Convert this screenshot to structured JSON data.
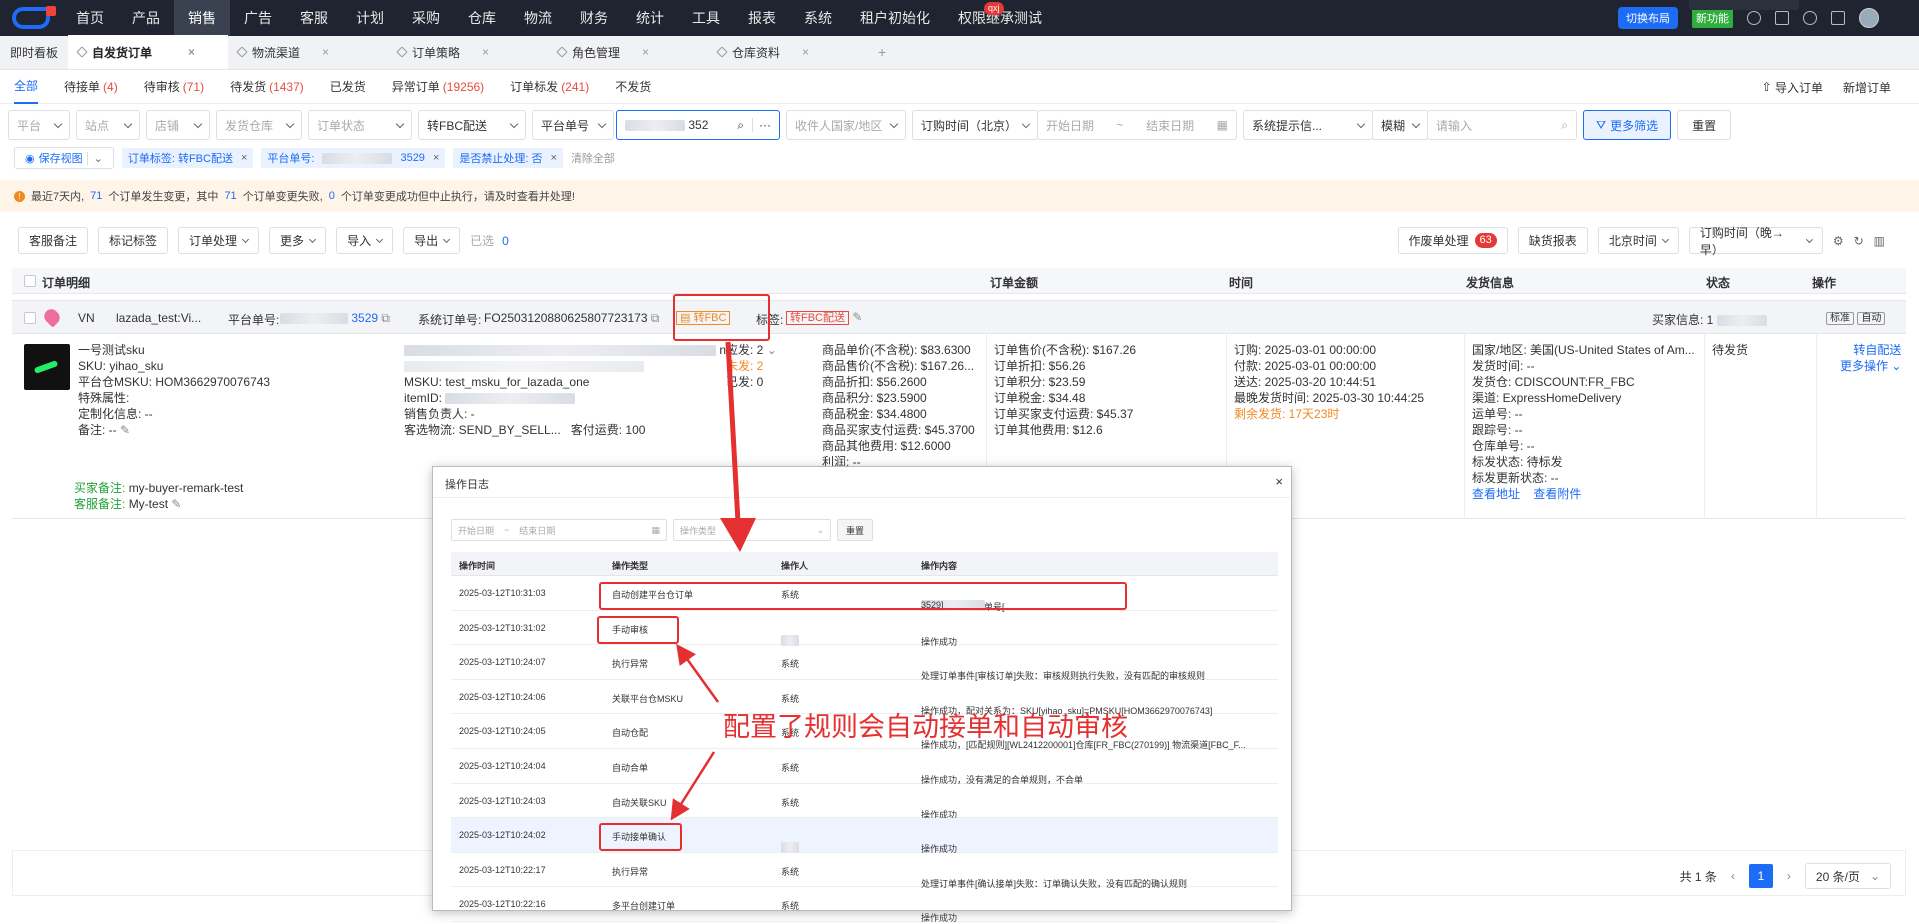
{
  "nav": {
    "items": [
      "首页",
      "产品",
      "销售",
      "广告",
      "客服",
      "计划",
      "采购",
      "仓库",
      "物流",
      "财务",
      "统计",
      "工具",
      "报表",
      "系统",
      "租户初始化",
      "权限继承测试"
    ],
    "active_index": 2,
    "badge": "qxj",
    "switch_layout": "切换布局",
    "new_feature": "新功能"
  },
  "tabs": {
    "items": [
      {
        "label": "即时看板"
      },
      {
        "label": "自发货订单",
        "active": true
      },
      {
        "label": "物流渠道"
      },
      {
        "label": "订单策略"
      },
      {
        "label": "角色管理"
      },
      {
        "label": "仓库资料"
      }
    ],
    "add": "+"
  },
  "subtabs": {
    "items": [
      {
        "label": "全部",
        "count": ""
      },
      {
        "label": "待接单",
        "count": "(4)"
      },
      {
        "label": "待审核",
        "count": "(71)"
      },
      {
        "label": "待发货",
        "count": "(1437)"
      },
      {
        "label": "已发货",
        "count": ""
      },
      {
        "label": "异常订单",
        "count": "(19256)"
      },
      {
        "label": "订单标发",
        "count": "(241)"
      },
      {
        "label": "不发货",
        "count": ""
      }
    ],
    "import": "导入订单",
    "add": "新增订单"
  },
  "filters": {
    "platform": "平台",
    "site": "站点",
    "shop": "店铺",
    "warehouse": "发货仓库",
    "status": "订单状态",
    "fbc": "转FBC配送",
    "order_no_type": "平台单号",
    "order_no_value": "352",
    "buyer_country": "收件人国家/地区",
    "time_type": "订购时间（北京）",
    "start": "开始日期",
    "end": "结束日期",
    "sys_hint": "系统提示信...",
    "fuzzy": "模糊",
    "input_ph": "请输入",
    "more": "更多筛选",
    "reset": "重置"
  },
  "chips": {
    "save_view": "保存视图",
    "items": [
      {
        "label": "订单标签: 转FBC配送"
      },
      {
        "label": "平台单号:",
        "value": "3529"
      },
      {
        "label": "是否禁止处理: 否"
      }
    ],
    "clear": "清除全部"
  },
  "notice": {
    "p1": "最近7天内,",
    "n1": "71",
    "p2": "个订单发生变更，其中",
    "n2": "71",
    "p3": "个订单变更失败,",
    "n3": "0",
    "p4": "个订单变更成功但中止执行，请及时查看并处理!"
  },
  "actions": {
    "buttons": [
      "客服备注",
      "标记标签",
      "订单处理",
      "更多",
      "导入",
      "导出"
    ],
    "selected": "已选",
    "selected_count": "0",
    "void": "作废单处理",
    "void_count": "63",
    "lack": "缺货报表",
    "tz": "北京时间",
    "sort": "订购时间（晚→早）"
  },
  "table": {
    "headers": [
      "订单明细",
      "订单金额",
      "时间",
      "发货信息",
      "状态",
      "操作"
    ]
  },
  "order": {
    "country": "VN",
    "shop": "lazada_test:Vi...",
    "platform_no_label": "平台单号:",
    "platform_no": "3529",
    "sys_no_label": "系统订单号:",
    "sys_no": "FO2503120880625807723173",
    "fbc_tag": "转FBC",
    "tag_label": "标签:",
    "tag": "转FBC配送",
    "buyer_label": "买家信息: 1",
    "btn_std": "标准",
    "btn_auto": "自动"
  },
  "detail": {
    "product": {
      "name": "一号测试sku",
      "sku": "SKU: yihao_sku",
      "msku": "平台仓MSKU: HOM3662970076743",
      "attr": "特殊属性:",
      "custom": "定制化信息: --",
      "remark": "备注: --"
    },
    "buyer_remark_label": "买家备注:",
    "buyer_remark": "my-buyer-remark-test",
    "cs_remark_label": "客服备注:",
    "cs_remark": "My-test",
    "item": {
      "msku": "MSKU:  test_msku_for_lazada_one",
      "item_id": "itemID:",
      "sales": "销售负责人:  -",
      "logistics": "客选物流:  SEND_BY_SELL...",
      "freight": "客付运费:  100",
      "suffix": "ne"
    },
    "qty": {
      "should": "应发:  2",
      "unship": "未发:  2",
      "shipped": "已发:  0"
    },
    "amounts1": [
      "商品单价(不含税): $83.6300",
      "商品售价(不含税): $167.26...",
      "商品折扣: $56.2600",
      "商品积分: $23.5900",
      "商品税金: $34.4800",
      "商品买家支付运费: $45.3700",
      "商品其他费用: $12.6000",
      "利润:  --"
    ],
    "amounts2": [
      "订单售价(不含税): $167.26",
      "订单折扣: $56.26",
      "订单积分: $23.59",
      "订单税金: $34.48",
      "订单买家支付运费: $45.37",
      "订单其他费用: $12.6"
    ],
    "times": [
      "订购:  2025-03-01 00:00:00",
      "付款:  2025-03-01 00:00:00",
      "送达:  2025-03-20 10:44:51",
      "最晚发货时间:  2025-03-30 10:44:25"
    ],
    "remain": "剩余发货: 17天23时",
    "ship": [
      "国家/地区:  美国(US-United States of Am...",
      "发货时间: --",
      "发货仓:  CDISCOUNT:FR_FBC",
      "渠道:  ExpressHomeDelivery",
      "运单号: --",
      "跟踪号: --",
      "仓库单号: --",
      "标发状态:  待标发",
      "标发更新状态: --"
    ],
    "view_addr": "查看地址",
    "view_attach": "查看附件",
    "status": "待发货",
    "op1": "转自配送",
    "op2": "更多操作"
  },
  "pager": {
    "total": "共 1 条",
    "page": "1",
    "size": "20 条/页"
  },
  "modal": {
    "title": "操作日志",
    "start": "开始日期",
    "end": "结束日期",
    "op_type": "操作类型",
    "reset": "重置",
    "headers": [
      "操作时间",
      "操作类型",
      "操作人",
      "操作内容"
    ],
    "rows": [
      {
        "time": "2025-03-12T10:31:03",
        "type": "自动创建平台仓订单",
        "user": "系统",
        "content": "操作成功，平台单号[",
        "content2": "3529]"
      },
      {
        "time": "2025-03-12T10:31:02",
        "type": "手动审核",
        "user": "",
        "content": "操作成功"
      },
      {
        "time": "2025-03-12T10:24:07",
        "type": "执行异常",
        "user": "系统",
        "content": "处理订单事件[审核订单]失败：审核规则执行失败，没有匹配的审核规则"
      },
      {
        "time": "2025-03-12T10:24:06",
        "type": "关联平台仓MSKU",
        "user": "系统",
        "content": "操作成功，配对关系为：SKU[yihao_sku]=PMSKU[HOM3662970076743]"
      },
      {
        "time": "2025-03-12T10:24:05",
        "type": "自动仓配",
        "user": "系统",
        "content": "操作成功，[匹配规则][WL2412200001]仓库[FR_FBC(270199)] 物流渠道[FBC_F..."
      },
      {
        "time": "2025-03-12T10:24:04",
        "type": "自动合单",
        "user": "系统",
        "content": "操作成功，没有满足的合单规则，不合单"
      },
      {
        "time": "2025-03-12T10:24:03",
        "type": "自动关联SKU",
        "user": "系统",
        "content": "操作成功"
      },
      {
        "time": "2025-03-12T10:24:02",
        "type": "手动接单确认",
        "user": "",
        "content": "操作成功"
      },
      {
        "time": "2025-03-12T10:22:17",
        "type": "执行异常",
        "user": "系统",
        "content": "处理订单事件[确认接单]失败：订单确认失败，没有匹配的确认规则"
      },
      {
        "time": "2025-03-12T10:22:16",
        "type": "多平台创建订单",
        "user": "系统",
        "content": "操作成功"
      }
    ]
  },
  "annotation": "配置了规则会自动接单和自动审核",
  "colors": {
    "primary": "#1d6cf5",
    "danger": "#e43030",
    "topbar": "#1f2430"
  }
}
